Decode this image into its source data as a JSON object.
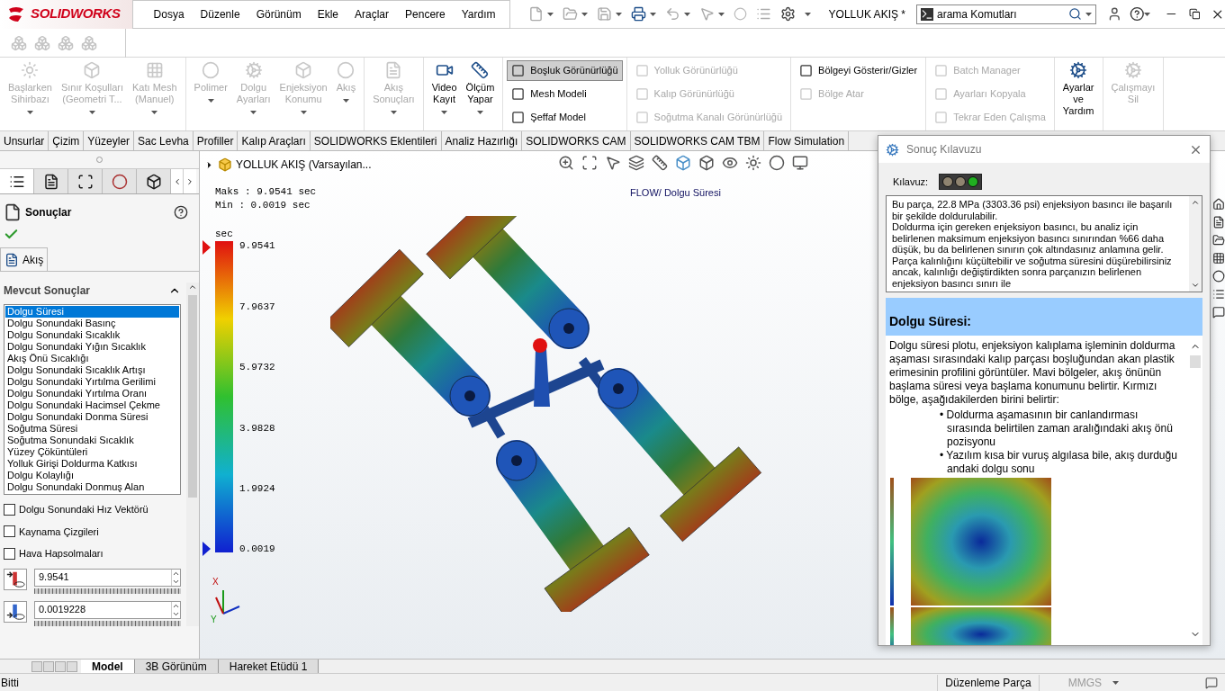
{
  "app_bar": {
    "logo": "SOLIDWORKS",
    "menu": [
      "Dosya",
      "Düzenle",
      "Görünüm",
      "Ekle",
      "Araçlar",
      "Pencere",
      "Yardım"
    ],
    "document_title": "YOLLUK AKIŞ *",
    "search": {
      "value": "arama Komutları"
    }
  },
  "ribbon": {
    "groups": [
      {
        "kind": "large",
        "items": [
          {
            "lines": [
              "Başlarken",
              "Sihirbazı"
            ],
            "disabled": true,
            "dropdown": true
          },
          {
            "lines": [
              "Sınır Koşulları",
              "(Geometri T..."
            ],
            "disabled": true,
            "dropdown": true
          },
          {
            "lines": [
              "Katı Mesh",
              "(Manuel)"
            ],
            "disabled": true,
            "dropdown": true
          }
        ]
      },
      {
        "kind": "large",
        "items": [
          {
            "lines": [
              "Polimer"
            ],
            "disabled": true,
            "dropdown": true
          },
          {
            "lines": [
              "Dolgu",
              "Ayarları"
            ],
            "disabled": true,
            "dropdown": true
          },
          {
            "lines": [
              "Enjeksiyon",
              "Konumu"
            ],
            "disabled": true,
            "dropdown": true
          },
          {
            "lines": [
              "Akış"
            ],
            "disabled": true,
            "dropdown": true
          }
        ]
      },
      {
        "kind": "large",
        "items": [
          {
            "lines": [
              "Akış",
              "Sonuçları"
            ],
            "disabled": true,
            "dropdown": true
          }
        ]
      },
      {
        "kind": "large",
        "items": [
          {
            "lines": [
              "Video",
              "Kayıt"
            ],
            "disabled": false,
            "dropdown": true
          },
          {
            "lines": [
              "Ölçüm",
              "Yapar"
            ],
            "disabled": false,
            "dropdown": true
          }
        ]
      },
      {
        "kind": "column",
        "items": [
          {
            "label": "Boşluk Görünürlüğü",
            "disabled": false,
            "pressed": true
          },
          {
            "label": "Mesh Modeli",
            "disabled": false,
            "pressed": false
          },
          {
            "label": "Şeffaf Model",
            "disabled": false,
            "pressed": false
          }
        ]
      },
      {
        "kind": "column",
        "items": [
          {
            "label": "Yolluk Görünürlüğü",
            "disabled": true,
            "pressed": false
          },
          {
            "label": "Kalıp Görünürlüğü",
            "disabled": true,
            "pressed": false
          },
          {
            "label": "Soğutma Kanalı Görünürlüğü",
            "disabled": true,
            "pressed": false
          }
        ]
      },
      {
        "kind": "column",
        "items": [
          {
            "label": "Bölgeyi Gösterir/Gizler",
            "disabled": false,
            "pressed": false
          },
          {
            "label": "Bölge Atar",
            "disabled": true,
            "pressed": false
          }
        ]
      },
      {
        "kind": "column",
        "items": [
          {
            "label": "Batch Manager",
            "disabled": true,
            "pressed": false
          },
          {
            "label": "Ayarları Kopyala",
            "disabled": true,
            "pressed": false
          },
          {
            "label": "Tekrar Eden Çalışma",
            "disabled": true,
            "pressed": false
          }
        ]
      },
      {
        "kind": "large",
        "items": [
          {
            "lines": [
              "Ayarlar",
              "ve",
              "Yardım"
            ],
            "disabled": false,
            "dropdown": false
          }
        ]
      },
      {
        "kind": "large",
        "items": [
          {
            "lines": [
              "Çalışmayı",
              "Sil"
            ],
            "disabled": true,
            "dropdown": false
          }
        ]
      }
    ]
  },
  "command_tabs": [
    "Unsurlar",
    "Çizim",
    "Yüzeyler",
    "Sac Levha",
    "Profiller",
    "Kalıp Araçları",
    "SOLIDWORKS Eklentileri",
    "Analiz Hazırlığı",
    "SOLIDWORKS CAM",
    "SOLIDWORKS CAM TBM",
    "Flow Simulation"
  ],
  "property_manager": {
    "panel_tabs": [
      {
        "selected": true
      },
      {
        "selected": false
      },
      {
        "selected": false
      },
      {
        "selected": false
      },
      {
        "selected": false
      }
    ],
    "title": "Sonuçlar",
    "tab": "Akış",
    "group_title": "Mevcut Sonuçlar",
    "expanded": true,
    "results": [
      {
        "label": "Dolgu Süresi",
        "selected": true
      },
      {
        "label": "Dolgu Sonundaki Basınç",
        "selected": false
      },
      {
        "label": "Dolgu Sonundaki Sıcaklık",
        "selected": false
      },
      {
        "label": "Dolgu Sonundaki Yığın Sıcaklık",
        "selected": false
      },
      {
        "label": "Akış Önü Sıcaklığı",
        "selected": false
      },
      {
        "label": "Dolgu Sonundaki Sıcaklık Artışı",
        "selected": false
      },
      {
        "label": "Dolgu Sonundaki Yırtılma Gerilimi",
        "selected": false
      },
      {
        "label": "Dolgu Sonundaki Yırtılma Oranı",
        "selected": false
      },
      {
        "label": "Dolgu Sonundaki Hacimsel Çekme",
        "selected": false
      },
      {
        "label": "Dolgu Sonundaki Donma Süresi",
        "selected": false
      },
      {
        "label": "Soğutma Süresi",
        "selected": false
      },
      {
        "label": "Soğutma Sonundaki Sıcaklık",
        "selected": false
      },
      {
        "label": "Yüzey Çöküntüleri",
        "selected": false
      },
      {
        "label": "Yolluk Girişi Doldurma Katkısı",
        "selected": false
      },
      {
        "label": "Dolgu Kolaylığı",
        "selected": false
      },
      {
        "label": "Dolgu Sonundaki Donmuş Alan",
        "selected": false
      }
    ],
    "options": [
      {
        "label": "Dolgu Sonundaki Hız Vektörü",
        "checked": false
      },
      {
        "label": "Kaynama Çizgileri",
        "checked": false
      },
      {
        "label": "Hava Hapsolmaları",
        "checked": false
      }
    ],
    "range_fields": [
      {
        "kind": "max",
        "value": "9.9541"
      },
      {
        "kind": "min",
        "value": "0.0019228"
      }
    ]
  },
  "viewport": {
    "tree_label": "YOLLUK AKIŞ  (Varsayılan...",
    "stats": [
      "Maks : 9.9541 sec",
      "Min : 0.0019 sec"
    ],
    "plot_title": "FLOW/ Dolgu Süresi",
    "legend": {
      "unit": "sec",
      "labels": [
        "9.9541",
        "7.9637",
        "5.9732",
        "3.9828",
        "1.9924",
        "0.0019"
      ]
    },
    "triad": [
      "X",
      "Y"
    ]
  },
  "result_advisor": {
    "title": "Sonuç Kılavuzu",
    "indicator_label": "Kılavuz:",
    "lights": [
      {
        "on": false
      },
      {
        "on": false
      },
      {
        "on": true
      }
    ],
    "summary": [
      "Bu parça, 22.8 MPa (3303.36 psi) enjeksiyon basıncı ile başarılı bir şekilde doldurulabilir.",
      "Doldurma için gereken enjeksiyon basıncı, bu analiz için belirlenen maksimum enjeksiyon basıncı sınırından %66 daha düşük, bu da belirlenen sınırın çok altındasınız anlamına gelir.",
      "Parça kalınlığını küçültebilir ve soğutma süresini düşürebilirsiniz ancak, kalınlığı değiştirdikten sonra parçanızın belirlenen enjeksiyon basıncı sınırı ile"
    ],
    "heading": "Dolgu Süresi:",
    "description": "Dolgu süresi plotu, enjeksiyon kalıplama işleminin doldurma aşaması sırasındaki kalıp parçası boşluğundan akan plastik erimesinin profilini görüntüler. Mavi bölgeler, akış önünün başlama süresi veya başlama konumunu belirtir. Kırmızı bölge, aşağıdakilerden birini belirtir:",
    "bullet_mark": "•",
    "bullets": [
      "Doldurma aşamasının bir canlandırması sırasında belirtilen zaman aralığındaki akış önü pozisyonu",
      "Yazılım kısa bir vuruş algılasa bile, akış durduğu andaki dolgu sonu"
    ]
  },
  "model_tabs": [
    {
      "label": "Model",
      "selected": true
    },
    {
      "label": "3B Görünüm",
      "selected": false
    },
    {
      "label": "Hareket Etüdü 1",
      "selected": false
    }
  ],
  "status_bar": {
    "message": "Bitti",
    "mode": "Düzenleme Parça",
    "units": "MMGS"
  }
}
